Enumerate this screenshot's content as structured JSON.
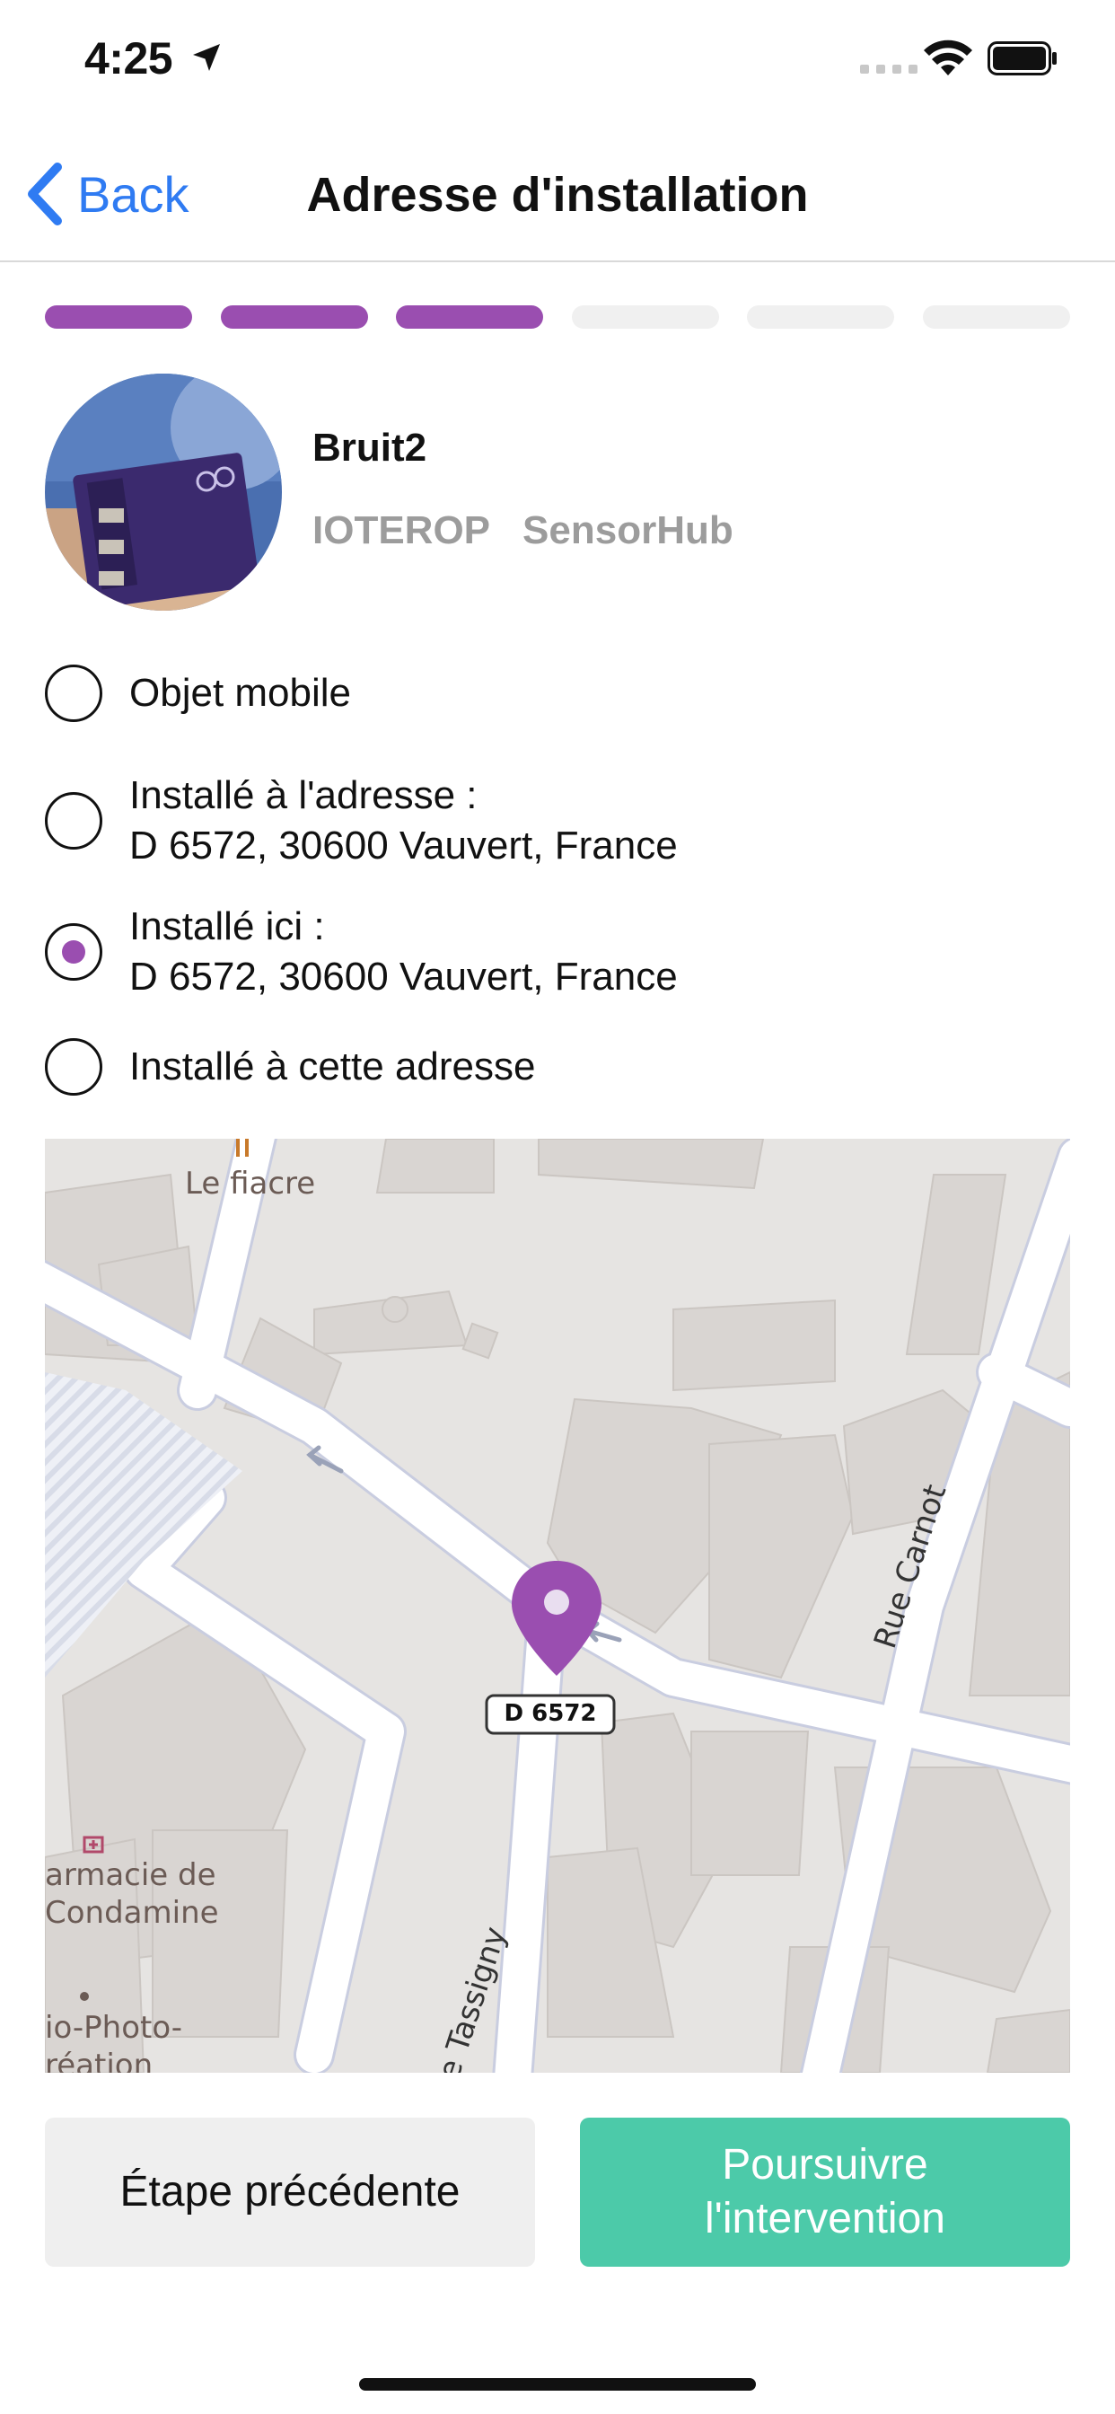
{
  "status_bar": {
    "time": "4:25"
  },
  "nav": {
    "back_label": "Back",
    "title": "Adresse d'installation"
  },
  "progress": {
    "total_steps": 6,
    "completed_steps": 3,
    "accent_color": "#9a4eb0"
  },
  "device": {
    "name": "Bruit2",
    "tags": [
      "IOTEROP",
      "SensorHub"
    ]
  },
  "options": [
    {
      "line1": "Objet mobile",
      "line2": "",
      "selected": false
    },
    {
      "line1": "Installé à l'adresse :",
      "line2": "D 6572, 30600 Vauvert, France",
      "selected": false
    },
    {
      "line1": "Installé ici :",
      "line2": "D 6572, 30600 Vauvert, France",
      "selected": true
    },
    {
      "line1": "Installé à cette adresse",
      "line2": "",
      "selected": false
    }
  ],
  "map": {
    "labels": {
      "poi_fiacre": "Le fiacre",
      "street_carnot": "Rue Carnot",
      "road_shield": "D 6572",
      "pharmacy_1": "armacie de",
      "pharmacy_2": "Condamine",
      "photo_1": "io-Photo-",
      "photo_2": "réation",
      "street_tassigny": "e Tassigny"
    },
    "pin_color": "#9a4eb0"
  },
  "buttons": {
    "previous": "Étape précédente",
    "continue_line1": "Poursuivre",
    "continue_line2": "l'intervention"
  }
}
